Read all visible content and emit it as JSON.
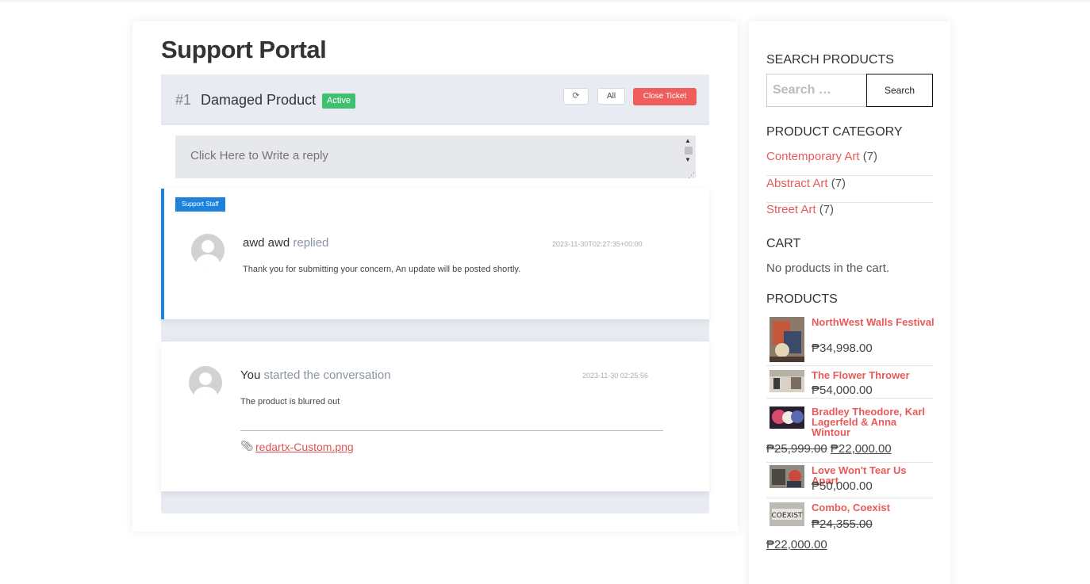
{
  "page": {
    "title": "Support Portal"
  },
  "ticket": {
    "number": "#1",
    "title": "Damaged Product",
    "status": "Active",
    "refresh_icon": "refresh-icon",
    "all_label": "All",
    "close_label": "Close Ticket",
    "reply_placeholder": "Click Here to Write a reply"
  },
  "messages": [
    {
      "tag": "Support Staff",
      "author": "awd awd",
      "verb": "replied",
      "time": "2023-11-30T02:27:35+00:00",
      "text": "Thank you for submitting your concern, An update will be posted shortly."
    },
    {
      "author": "You",
      "verb": "started the conversation",
      "time": "2023-11-30 02:25:56",
      "text": "The product is blurred out",
      "attachment": "redartx-Custom.png",
      "attachment_icon": "paperclip-icon"
    }
  ],
  "sidebar": {
    "search": {
      "title": "SEARCH PRODUCTS",
      "placeholder": "Search …",
      "button": "Search"
    },
    "categories": {
      "title": "PRODUCT CATEGORY",
      "items": [
        {
          "name": "Contemporary Art",
          "count": "(7)"
        },
        {
          "name": "Abstract Art",
          "count": "(7)"
        },
        {
          "name": "Street Art",
          "count": "(7)"
        }
      ]
    },
    "cart": {
      "title": "CART",
      "empty": "No products in the cart."
    },
    "products": {
      "title": "PRODUCTS",
      "items": [
        {
          "name": "NorthWest Walls Festival",
          "price": "₱34,998.00"
        },
        {
          "name": "The Flower Thrower",
          "price": "₱54,000.00"
        },
        {
          "name": "Bradley Theodore, Karl Lagerfeld & Anna Wintour",
          "old_price": "₱25,999.00",
          "price": "₱22,000.00"
        },
        {
          "name": "Love Won't Tear Us Apart",
          "price": "₱50,000.00"
        },
        {
          "name": "Combo, Coexist",
          "old_price": "₱24,355.00",
          "price": "₱22,000.00"
        }
      ]
    }
  }
}
